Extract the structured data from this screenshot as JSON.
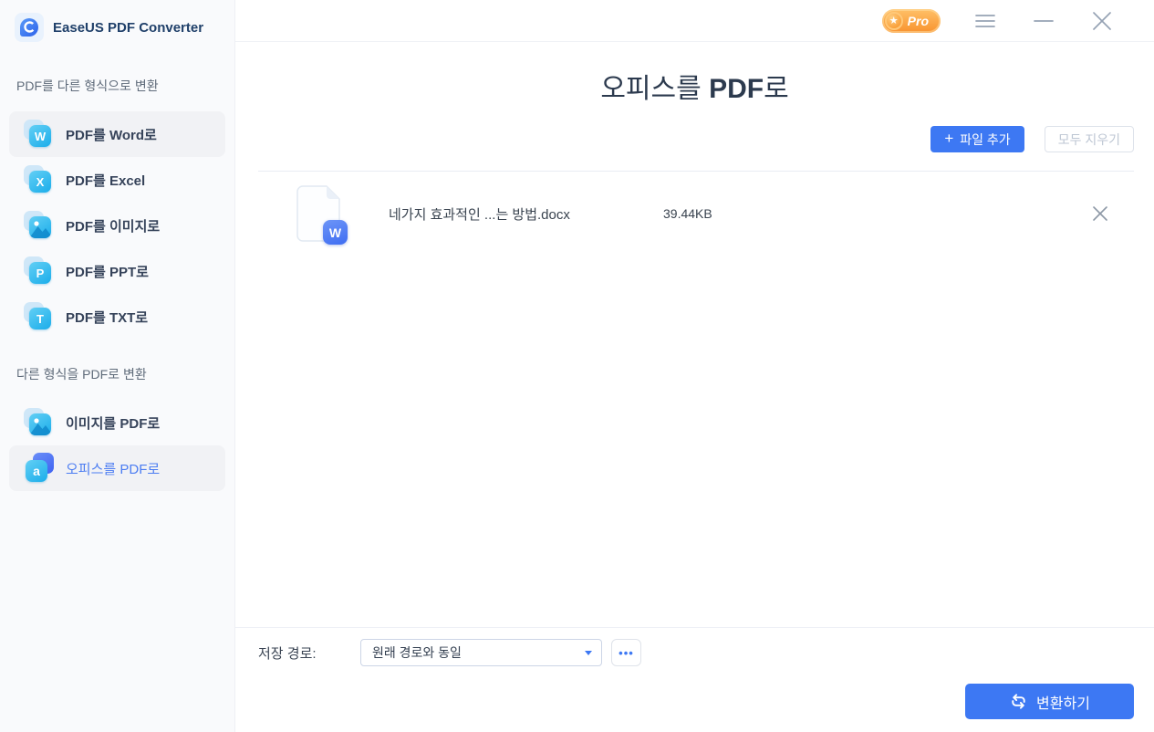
{
  "window": {
    "app_title": "EaseUS PDF Converter",
    "pro_badge": "Pro",
    "pro_star": "★"
  },
  "sidebar": {
    "sections": [
      {
        "label": "PDF를 다른 형식으로 변환",
        "items": [
          {
            "label": "PDF를 Word로",
            "icon": "word-icon",
            "letter": "W"
          },
          {
            "label": "PDF를 Excel",
            "icon": "excel-icon",
            "letter": "X"
          },
          {
            "label": "PDF를 이미지로",
            "icon": "image-icon"
          },
          {
            "label": "PDF를 PPT로",
            "icon": "ppt-icon",
            "letter": "P"
          },
          {
            "label": "PDF를 TXT로",
            "icon": "txt-icon",
            "letter": "T"
          }
        ]
      },
      {
        "label": "다른 형식을 PDF로 변환",
        "items": [
          {
            "label": "이미지를 PDF로",
            "icon": "image-icon"
          },
          {
            "label": "오피스를 PDF로",
            "icon": "office-icon",
            "letter": "a",
            "selected": true
          }
        ]
      }
    ]
  },
  "main": {
    "title_parts": {
      "pre": "오피스를 ",
      "bold": "PDF",
      "post": "로"
    },
    "add_files_plus": "+",
    "add_files_button": "파일 추가",
    "clear_all_button": "모두 지우기",
    "files": [
      {
        "name": "네가지 효과적인 ...는 방법.docx",
        "size": "39.44KB",
        "type_badge": "W"
      }
    ]
  },
  "footer": {
    "save_path_label": "저장 경로:",
    "save_path_value": "원래 경로와 동일",
    "browse_button": "•••",
    "convert_button": "변환하기"
  },
  "colors": {
    "accent_blue": "#3d78f3",
    "selected_blue": "#4c7df2",
    "cyan_icon": "#1badea",
    "pro_orange": "#f8922e",
    "sidebar_bg": "#f9fafc"
  }
}
